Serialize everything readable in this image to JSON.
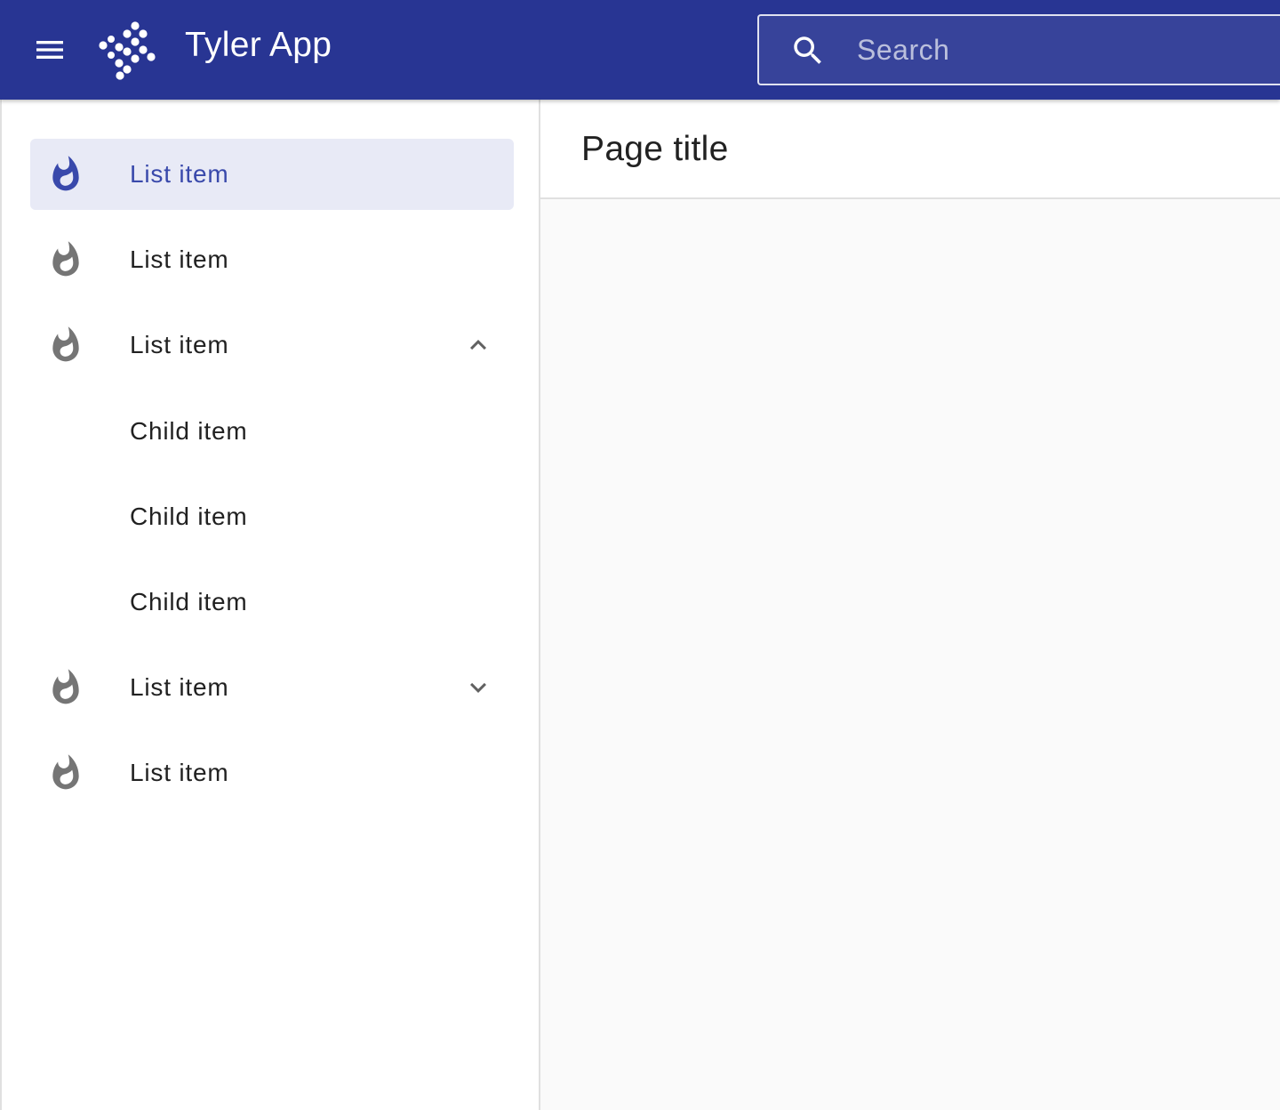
{
  "header": {
    "app_title": "Tyler App",
    "menu_icon": "menu-icon",
    "logo": "tyler-logo",
    "search": {
      "placeholder": "Search",
      "value": "",
      "icon": "search-icon"
    }
  },
  "sidebar": {
    "items": [
      {
        "label": "List item",
        "icon": "fire-icon",
        "selected": true
      },
      {
        "label": "List item",
        "icon": "fire-icon"
      },
      {
        "label": "List item",
        "icon": "fire-icon",
        "expanded": true,
        "children": [
          {
            "label": "Child item"
          },
          {
            "label": "Child item"
          },
          {
            "label": "Child item"
          }
        ]
      },
      {
        "label": "List item",
        "icon": "fire-icon",
        "expanded": false
      },
      {
        "label": "List item",
        "icon": "fire-icon"
      }
    ]
  },
  "main": {
    "page_title": "Page title"
  },
  "colors": {
    "app_bar": "#283593",
    "selected_bg": "#e8eaf6",
    "selected_text": "#3949ab",
    "icon_gray": "#757575",
    "content_bg": "#fafafa"
  }
}
